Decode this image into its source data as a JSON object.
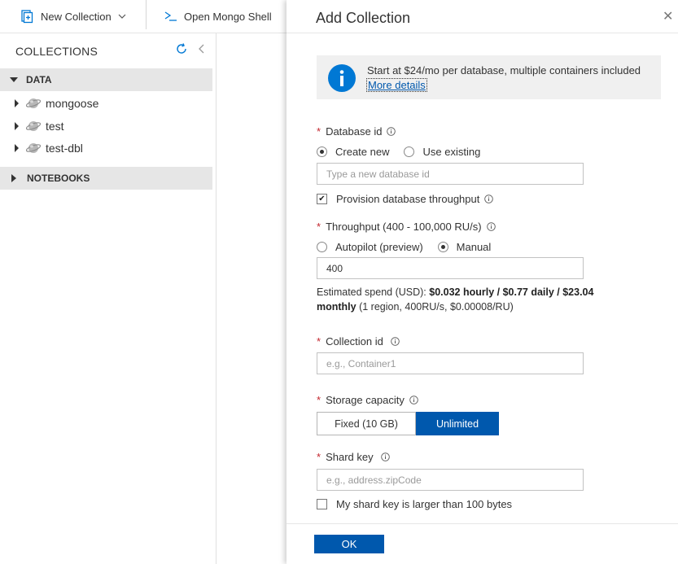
{
  "toolbar": {
    "new_collection_label": "New Collection",
    "open_shell_label": "Open Mongo Shell"
  },
  "left_panel": {
    "title": "COLLECTIONS",
    "sections": {
      "data": "DATA",
      "notebooks": "NOTEBOOKS"
    },
    "databases": [
      "mongoose",
      "test",
      "test-dbl"
    ]
  },
  "dialog": {
    "title": "Add Collection",
    "info": {
      "text": "Start at $24/mo per database, multiple containers included",
      "link": "More details"
    },
    "database_id": {
      "label": "Database id",
      "option_new": "Create new",
      "option_existing": "Use existing",
      "selected": "Create new",
      "placeholder": "Type a new database id",
      "value": ""
    },
    "provision": {
      "label": "Provision database throughput",
      "checked": true
    },
    "throughput": {
      "label": "Throughput (400 - 100,000 RU/s)",
      "option_autopilot": "Autopilot (preview)",
      "option_manual": "Manual",
      "selected": "Manual",
      "value": "400"
    },
    "spend": {
      "prefix": "Estimated spend (USD): ",
      "bold": "$0.032 hourly / $0.77 daily / $23.04 monthly",
      "suffix": " (1 region, 400RU/s, $0.00008/RU)"
    },
    "collection_id": {
      "label": "Collection id",
      "placeholder": "e.g., Container1",
      "value": ""
    },
    "storage": {
      "label": "Storage capacity",
      "option_fixed": "Fixed (10 GB)",
      "option_unlimited": "Unlimited",
      "selected": "Unlimited"
    },
    "shard_key": {
      "label": "Shard key",
      "placeholder": "e.g., address.zipCode",
      "value": "",
      "large_label": "My shard key is larger than 100 bytes",
      "large_checked": false
    },
    "ok_label": "OK",
    "close_symbol": "✕"
  },
  "colors": {
    "accent": "#0058ad",
    "required": "#c4262e",
    "section_bg": "#e6e6e6",
    "info_bg": "#f0f0f0",
    "icon_blue": "#0078d4"
  }
}
